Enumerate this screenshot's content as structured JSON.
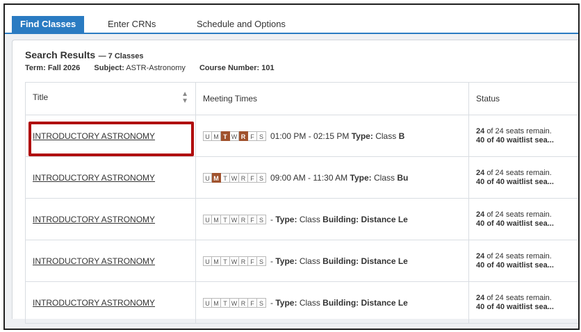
{
  "tabs": [
    {
      "label": "Find Classes",
      "active": true
    },
    {
      "label": "Enter CRNs",
      "active": false
    },
    {
      "label": "Schedule and Options",
      "active": false
    }
  ],
  "search": {
    "title": "Search Results",
    "count": "— 7 Classes",
    "term_label": "Term:",
    "term_value": "Fall 2026",
    "subject_label": "Subject:",
    "subject_value": "ASTR-Astronomy",
    "course_label": "Course Number:",
    "course_value": "101"
  },
  "table": {
    "headers": [
      "Title",
      "Meeting Times",
      "Status"
    ],
    "day_letters": [
      "U",
      "M",
      "T",
      "W",
      "R",
      "F",
      "S"
    ],
    "rows": [
      {
        "title": "INTRODUCTORY ASTRONOMY",
        "active_days": [
          "T",
          "R"
        ],
        "meeting_text": "01:00 PM - 02:15 PM",
        "type_label": "Type:",
        "type_value": "Class",
        "trail": "B",
        "seats_num": "24",
        "seats_text": "of 24 seats remain.",
        "wait_num": "40",
        "wait_text": "of 40 waitlist sea..."
      },
      {
        "title": "INTRODUCTORY ASTRONOMY",
        "active_days": [
          "M"
        ],
        "meeting_text": "09:00 AM - 11:30 AM",
        "type_label": "Type:",
        "type_value": "Class",
        "trail": "Bu",
        "seats_num": "24",
        "seats_text": "of 24 seats remain.",
        "wait_num": "40",
        "wait_text": "of 40 waitlist sea..."
      },
      {
        "title": "INTRODUCTORY ASTRONOMY",
        "active_days": [],
        "meeting_text": "-",
        "type_label": "Type:",
        "type_value": "Class",
        "trail": "Building: Distance Le",
        "seats_num": "24",
        "seats_text": "of 24 seats remain.",
        "wait_num": "40",
        "wait_text": "of 40 waitlist sea..."
      },
      {
        "title": "INTRODUCTORY ASTRONOMY",
        "active_days": [],
        "meeting_text": "-",
        "type_label": "Type:",
        "type_value": "Class",
        "trail": "Building: Distance Le",
        "seats_num": "24",
        "seats_text": "of 24 seats remain.",
        "wait_num": "40",
        "wait_text": "of 40 waitlist sea..."
      },
      {
        "title": "INTRODUCTORY ASTRONOMY",
        "active_days": [],
        "meeting_text": "-",
        "type_label": "Type:",
        "type_value": "Class",
        "trail": "Building: Distance Le",
        "seats_num": "24",
        "seats_text": "of 24 seats remain.",
        "wait_num": "40",
        "wait_text": "of 40 waitlist sea..."
      }
    ]
  },
  "colors": {
    "accent": "#2a7bc2",
    "active_day": "#a0522d",
    "highlight_box": "#b00c0c"
  }
}
